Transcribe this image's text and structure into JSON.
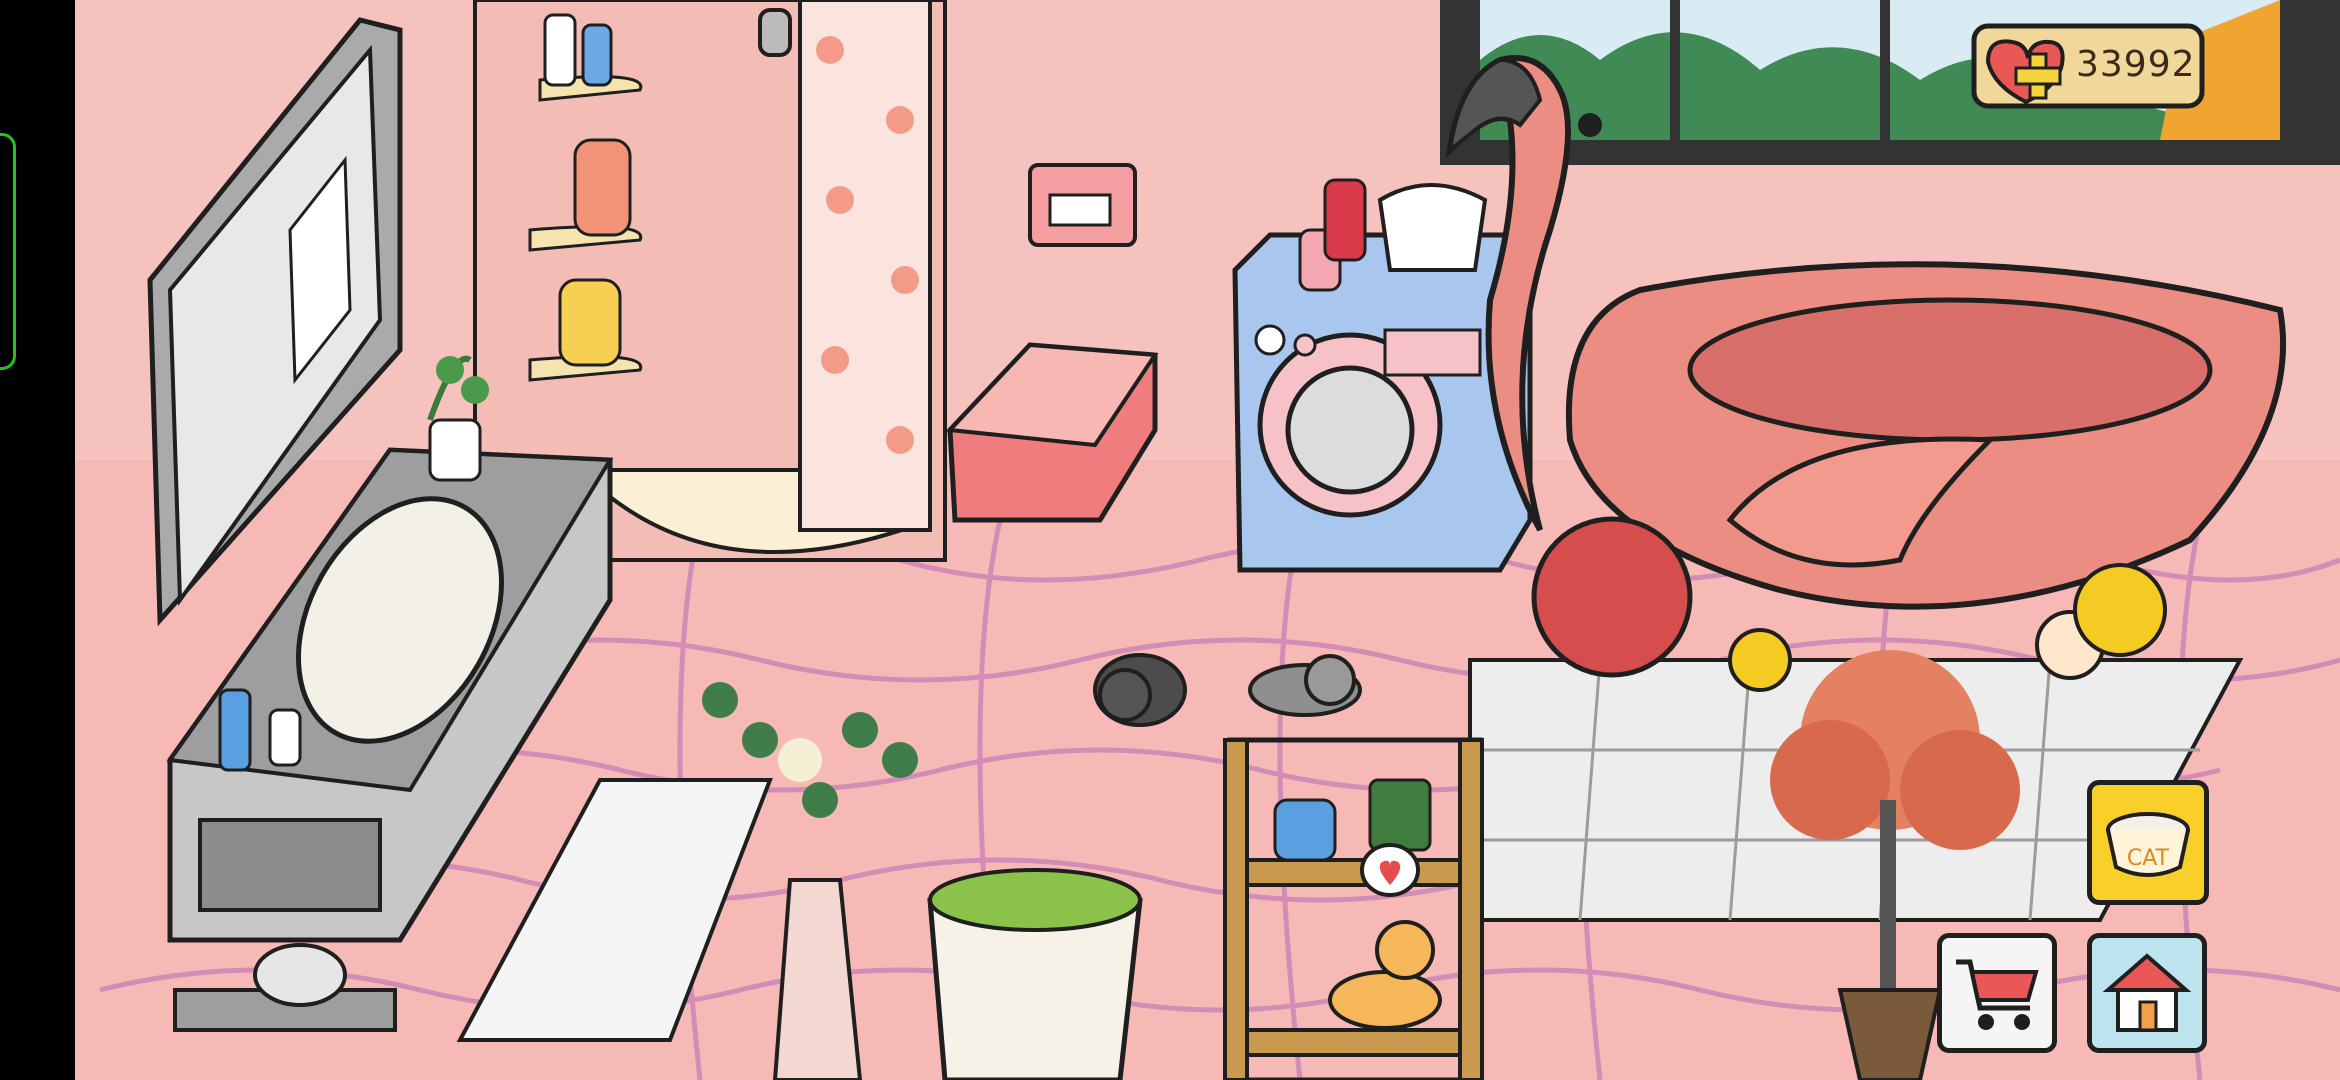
{
  "hud": {
    "hearts_value": "33992",
    "cat_bowl_label": "CAT"
  },
  "buttons": {
    "cat_food_icon": "cat-food-bowl-icon",
    "shop_icon": "shopping-cart-icon",
    "home_icon": "house-icon"
  },
  "colors": {
    "wall": "#f6c2bd",
    "floor": "#f7b9b6",
    "tile_line": "#d38cb6",
    "flamingo": "#ec8d83",
    "washer": "#a9c6ef",
    "cabinet": "#bfbfbf",
    "cat_button": "#f9cf2a",
    "home_button": "#bde3ee",
    "outline": "#1f1f1f"
  }
}
